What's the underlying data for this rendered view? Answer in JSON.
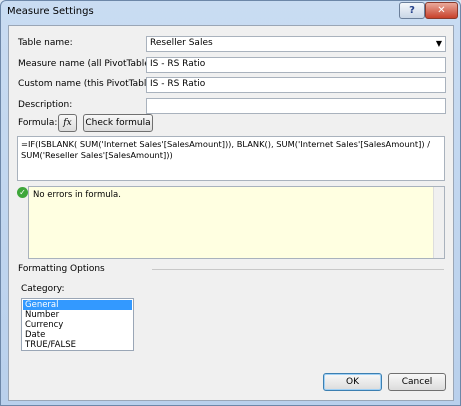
{
  "window": {
    "title": "Measure Settings",
    "help_label": "?",
    "close_label": "✕"
  },
  "fields": {
    "table_name_label": "Table name:",
    "table_name_value": "Reseller Sales",
    "measure_name_label": "Measure name (all PivotTables):",
    "measure_name_value": "IS - RS Ratio",
    "custom_name_label": "Custom name (this PivotTable):",
    "custom_name_value": "IS - RS Ratio",
    "description_label": "Description:",
    "description_value": "",
    "formula_label": "Formula:",
    "fx_label": "fx",
    "check_formula_label": "Check formula",
    "formula_value": "=IF(ISBLANK( SUM('Internet Sales'[SalesAmount])), BLANK(), SUM('Internet Sales'[SalesAmount]) / SUM('Reseller Sales'[SalesAmount]))"
  },
  "status": {
    "message": "No errors in formula."
  },
  "formatting": {
    "section_label": "Formatting Options",
    "category_label": "Category:",
    "options": [
      "General",
      "Number",
      "Currency",
      "Date",
      "TRUE/FALSE"
    ],
    "selected": "General"
  },
  "buttons": {
    "ok_label": "OK",
    "cancel_label": "Cancel"
  },
  "colors": {
    "selection": "#3399ff",
    "status_background": "#ffffe1",
    "close_button": "#c8412b"
  }
}
